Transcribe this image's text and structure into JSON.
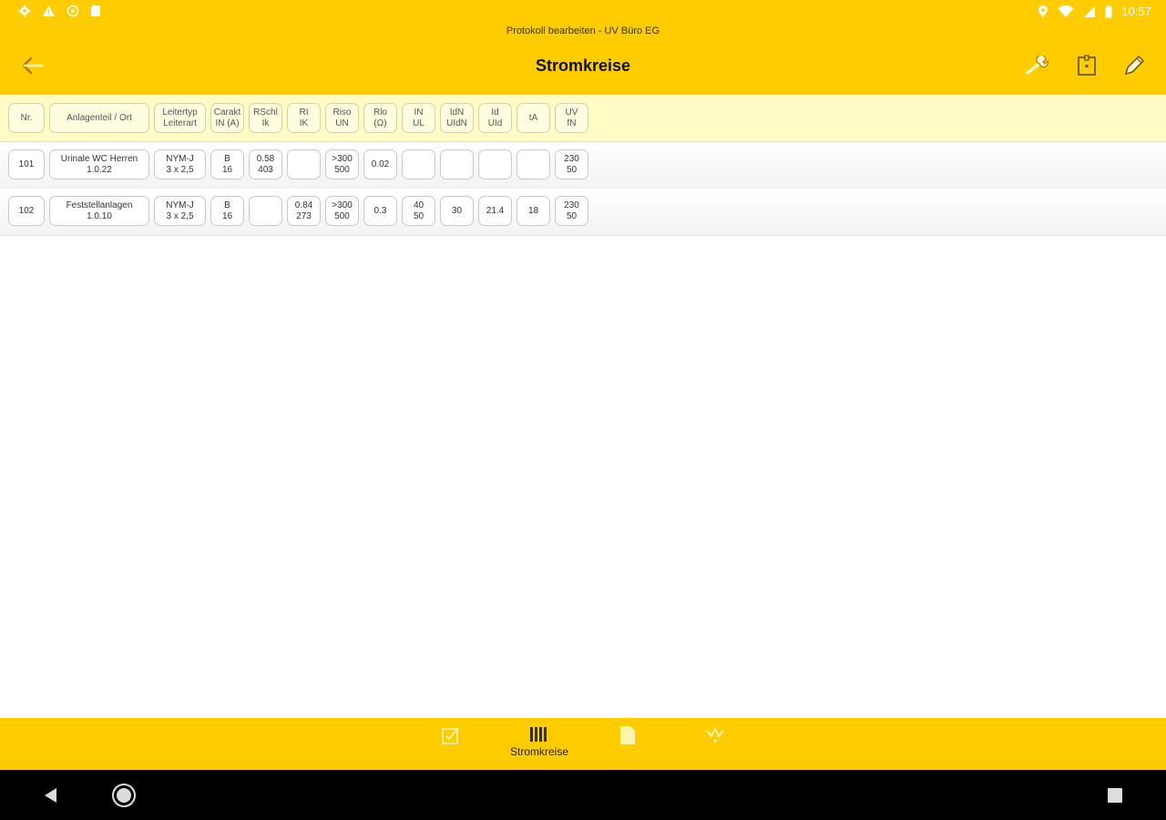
{
  "status_bar": {
    "time": "10:57",
    "left_icons": [
      "settings-icon",
      "warning-icon",
      "circle-icon",
      "sd-card-icon"
    ],
    "right_icons": [
      "location-icon",
      "wifi-icon",
      "signal-icon",
      "battery-icon"
    ]
  },
  "app_bar": {
    "subtitle": "Protokoll bearbeiten - UV Büro EG",
    "title": "Stromkreise",
    "back_icon": "back-arrow-icon",
    "actions": [
      "wrench-icon",
      "save-icon",
      "pencil-icon"
    ]
  },
  "table": {
    "headers": [
      [
        "Nr.",
        ""
      ],
      [
        "Anlagenteil / Ort",
        ""
      ],
      [
        "Leitertyp",
        "Leiterart"
      ],
      [
        "Carakt",
        "IN (A)"
      ],
      [
        "RSchl",
        "Ik"
      ],
      [
        "RI",
        "IK"
      ],
      [
        "Riso",
        "UN"
      ],
      [
        "Rlo",
        "(Ω)"
      ],
      [
        "IN",
        "UL"
      ],
      [
        "IdN",
        "UIdN"
      ],
      [
        "Id",
        "UId"
      ],
      [
        "tA",
        ""
      ],
      [
        "UV",
        "fN"
      ]
    ],
    "rows": [
      [
        [
          "101",
          ""
        ],
        [
          "Urinale WC Herren",
          "1.0.22"
        ],
        [
          "NYM-J",
          "3 x 2,5"
        ],
        [
          "B",
          "16"
        ],
        [
          "0.58",
          "403"
        ],
        [
          "",
          ""
        ],
        [
          ">300",
          "500"
        ],
        [
          "0.02",
          ""
        ],
        [
          "",
          ""
        ],
        [
          "",
          ""
        ],
        [
          "",
          ""
        ],
        [
          "",
          ""
        ],
        [
          "230",
          "50"
        ]
      ],
      [
        [
          "102",
          ""
        ],
        [
          "Feststellanlagen",
          "1.0.10"
        ],
        [
          "NYM-J",
          "3 x 2,5"
        ],
        [
          "B",
          "16"
        ],
        [
          "",
          ""
        ],
        [
          "0.84",
          "273"
        ],
        [
          ">300",
          "500"
        ],
        [
          "0.3",
          ""
        ],
        [
          "40",
          "50"
        ],
        [
          "30",
          ""
        ],
        [
          "21.4",
          ""
        ],
        [
          "18",
          ""
        ],
        [
          "230",
          "50"
        ]
      ]
    ]
  },
  "bottom_nav": {
    "items": [
      {
        "icon": "checklist-icon",
        "label": ""
      },
      {
        "icon": "circuits-icon",
        "label": "Stromkreise"
      },
      {
        "icon": "document-icon",
        "label": ""
      },
      {
        "icon": "signature-icon",
        "label": ""
      }
    ],
    "active": "Stromkreise"
  },
  "system_nav": [
    "back-triangle-icon",
    "home-circle-icon",
    "recents-square-icon"
  ]
}
